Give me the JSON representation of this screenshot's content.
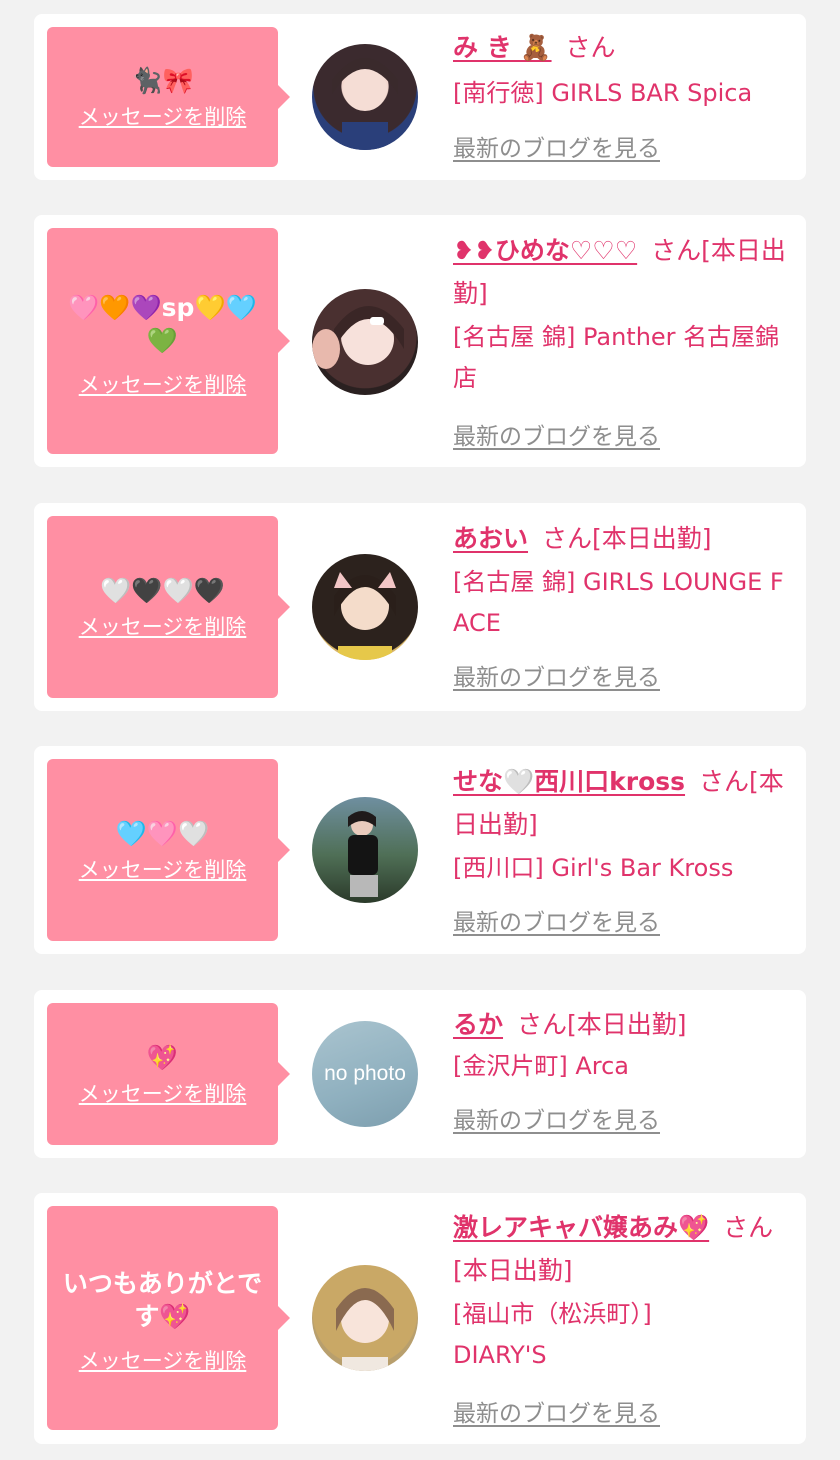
{
  "colors": {
    "accent": "#e0336b",
    "bubble": "#ff8fa3",
    "link_gray": "#8e8e8e",
    "background": "#f2f2f2"
  },
  "cards": [
    {
      "message": "🐈‍⬛🎀",
      "delete_label": "メッセージを削除",
      "name": "み き 🧸",
      "san": "さん",
      "shop": "[南行徳] GIRLS BAR Spica",
      "blog_label": "最新のブログを見る",
      "avatar_icon": "avatar-photo"
    },
    {
      "message": "🩷🧡💜sp💛🩵💚",
      "delete_label": "メッセージを削除",
      "name": "❥❥ひめな♡♡♡",
      "san": "さん[本日出勤]",
      "shop": "[名古屋 錦] Panther 名古屋錦店",
      "blog_label": "最新のブログを見る",
      "avatar_icon": "avatar-photo"
    },
    {
      "message": "🤍🖤🤍🖤",
      "delete_label": "メッセージを削除",
      "name": "あおい",
      "san": "さん[本日出勤]",
      "shop": "[名古屋 錦] GIRLS LOUNGE FACE",
      "blog_label": "最新のブログを見る",
      "avatar_icon": "avatar-photo"
    },
    {
      "message": "🩵🩷🤍",
      "delete_label": "メッセージを削除",
      "name": "せな🤍西川口kross",
      "san": "さん[本日出勤]",
      "shop": "[西川口] Girl's Bar Kross",
      "blog_label": "最新のブログを見る",
      "avatar_icon": "avatar-photo"
    },
    {
      "message": "💖",
      "delete_label": "メッセージを削除",
      "name": "るか",
      "san": "さん[本日出勤]",
      "shop": "[金沢片町] Arca",
      "blog_label": "最新のブログを見る",
      "avatar_text": "no photo",
      "avatar_icon": "no-photo-placeholder"
    },
    {
      "message": "いつもありがとです💖",
      "delete_label": "メッセージを削除",
      "name": "激レアキャバ嬢あみ💖",
      "san": "さん[本日出勤]",
      "shop": "[福山市（松浜町）] DIARY'S",
      "blog_label": "最新のブログを見る",
      "avatar_icon": "avatar-photo"
    }
  ]
}
